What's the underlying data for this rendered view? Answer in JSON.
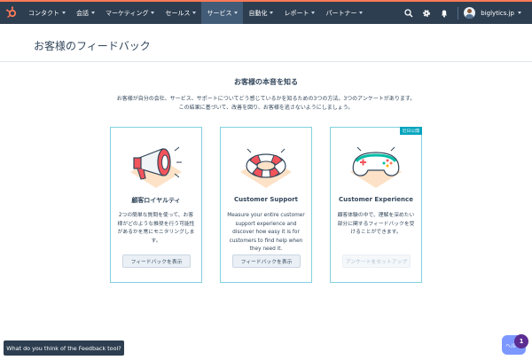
{
  "nav": {
    "items": [
      {
        "label": "コンタクト",
        "active": false
      },
      {
        "label": "会話",
        "active": false
      },
      {
        "label": "マーケティング",
        "active": false
      },
      {
        "label": "セールス",
        "active": false
      },
      {
        "label": "サービス",
        "active": true
      },
      {
        "label": "自動化",
        "active": false
      },
      {
        "label": "レポート",
        "active": false
      },
      {
        "label": "パートナー",
        "active": false
      }
    ],
    "account_name": "biglytics.jp",
    "icons": [
      "sprocket-logo-icon",
      "search-icon",
      "gear-icon",
      "bell-icon",
      "avatar"
    ]
  },
  "page": {
    "title": "お客様のフィードバック"
  },
  "hero": {
    "title": "お客様の本音を知る",
    "desc_line1": "お客様が自分の会社、サービス、サポートについてどう感じているかを知るための3つの方法。3つのアンケートがあります。",
    "desc_line2": "この結果に基づいて、改善を図り、お客様を逃さないようにしましょう。"
  },
  "cards": [
    {
      "title": "顧客ロイヤルティ",
      "text": "2つの簡単な質問を使って、お客様がどのような推奨を行う可能性があるかを常にモニタリングします。",
      "button": "フィードバックを表示",
      "button_disabled": false,
      "illustration": "megaphone-icon"
    },
    {
      "title": "Customer Support",
      "text": "Measure your entire customer support experience and discover how easy it is for customers to find help when they need it.",
      "button": "フィードバックを表示",
      "button_disabled": false,
      "illustration": "lifebuoy-icon"
    },
    {
      "title": "Customer Experience",
      "text": "顧客体験の中で、理解を深めたい部分に関するフィードバックを受けることができます。",
      "button": "アンケートをセットアップ",
      "button_disabled": true,
      "badge": "近日公開",
      "illustration": "gamepad-icon"
    }
  ],
  "feedback_tool": {
    "label": "What do you think of the Feedback tool?"
  },
  "chat": {
    "label": "ヘル",
    "count": "1"
  },
  "colors": {
    "topbar": "#2d3e50",
    "accent": "#ff7a59",
    "card_border": "#7fd1de",
    "badge": "#00a4bd",
    "chat": "#7c98ff"
  }
}
